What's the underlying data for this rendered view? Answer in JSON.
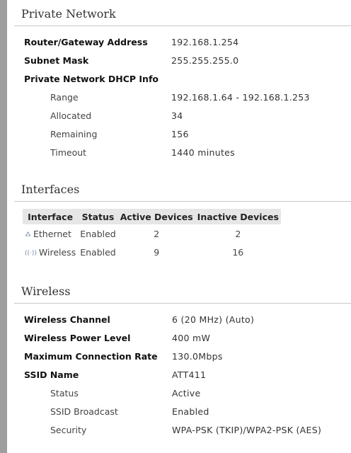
{
  "private_network": {
    "title": "Private Network",
    "rows": [
      {
        "label": "Router/Gateway Address",
        "value": "192.168.1.254"
      },
      {
        "label": "Subnet Mask",
        "value": "255.255.255.0"
      },
      {
        "label": "Private Network DHCP Info",
        "value": ""
      }
    ],
    "dhcp": [
      {
        "label": "Range",
        "value": "192.168.1.64 - 192.168.1.253"
      },
      {
        "label": "Allocated",
        "value": "34"
      },
      {
        "label": "Remaining",
        "value": "156"
      },
      {
        "label": "Timeout",
        "value": "1440 minutes"
      }
    ]
  },
  "interfaces": {
    "title": "Interfaces",
    "headers": [
      "Interface",
      "Status",
      "Active Devices",
      "Inactive Devices"
    ],
    "rows": [
      {
        "icon": "ethernet-icon",
        "name": "Ethernet",
        "status": "Enabled",
        "active": "2",
        "inactive": "2"
      },
      {
        "icon": "wireless-icon",
        "name": "Wireless",
        "status": "Enabled",
        "active": "9",
        "inactive": "16"
      }
    ]
  },
  "wireless": {
    "title": "Wireless",
    "rows": [
      {
        "label": "Wireless Channel",
        "value": "6 (20 MHz) (Auto)"
      },
      {
        "label": "Wireless Power Level",
        "value": "400 mW"
      },
      {
        "label": "Maximum Connection Rate",
        "value": "130.0Mbps"
      },
      {
        "label": "SSID Name",
        "value": "ATT411"
      }
    ],
    "ssid": [
      {
        "label": "Status",
        "value": "Active"
      },
      {
        "label": "SSID Broadcast",
        "value": "Enabled"
      },
      {
        "label": "Security",
        "value": "WPA-PSK (TKIP)/WPA2-PSK (AES)"
      }
    ]
  }
}
